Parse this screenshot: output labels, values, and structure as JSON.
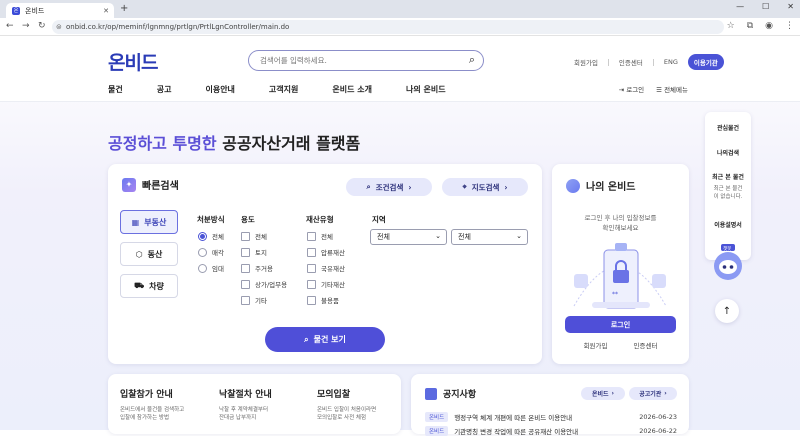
{
  "browser": {
    "tab_title": "온비드",
    "favicon_text": "온",
    "url": "onbid.co.kr/op/meminf/lgnmng/prtlgn/PrtlLgnController/main.do"
  },
  "header": {
    "logo": "온비드",
    "search_placeholder": "검색어를 입력하세요.",
    "util": {
      "join": "회원가입",
      "cert": "인증센터",
      "lang": "ENG",
      "guide": "이용기관"
    },
    "nav": [
      "물건",
      "공고",
      "이용안내",
      "고객지원",
      "온비드 소개",
      "나의 온비드"
    ],
    "login": "로그인",
    "all_menu": "전체메뉴"
  },
  "hero": {
    "highlight": "공정하고 투명한",
    "rest": " 공공자산거래 플랫폼"
  },
  "quick_search": {
    "title": "빠른검색",
    "cond_button": "조건검색",
    "map_button": "지도검색",
    "assets": [
      "부동산",
      "동산",
      "차량"
    ],
    "col_method": "처분방식",
    "methods": [
      "전체",
      "매각",
      "임대"
    ],
    "col_use": "용도",
    "uses": [
      "전체",
      "토지",
      "주거용",
      "상가/업무용",
      "기타"
    ],
    "col_type": "재산유형",
    "types": [
      "전체",
      "압류재산",
      "국유재산",
      "기타재산",
      "불용품"
    ],
    "col_region": "지역",
    "region1": "전체",
    "region2": "전체",
    "view_button": "물건 보기"
  },
  "my_onbid": {
    "title": "나의 온비드",
    "desc1": "로그인 후 나의 입찰정보를",
    "desc2": "확인해보세요",
    "login_button": "로그인",
    "join": "회원가입",
    "cert": "인증센터"
  },
  "side_menu": {
    "interest": "관심물건",
    "my_search": "나의검색",
    "recent": "최근 본 물건",
    "recent_desc1": "최근 본 물건",
    "recent_desc2": "이 없습니다.",
    "guide": "이용설명서",
    "bot_label": "챗봇"
  },
  "guide_cards": [
    {
      "title": "입찰참가 안내",
      "desc1": "온비드에서 물건을 검색하고",
      "desc2": "입찰에 참가하는 방법"
    },
    {
      "title": "낙찰절차 안내",
      "desc1": "낙찰 후 계약체결부터",
      "desc2": "잔대금 납부까지"
    },
    {
      "title": "모의입찰",
      "desc1": "온비드 입찰이 처음이라면",
      "desc2": "모의입찰로 사전 체험"
    }
  ],
  "notice": {
    "title": "공지사항",
    "btn_onbid": "온비드",
    "btn_agency": "공고기관",
    "rows": [
      {
        "chip": "온비드",
        "text": "행정구역 체계 개편에 따른 온비드 이용안내",
        "date": "2026-06-23"
      },
      {
        "chip": "온비드",
        "text": "기관명칭 변경 작업에 따른 공유재산 이용안내",
        "date": "2026-06-22"
      }
    ]
  }
}
